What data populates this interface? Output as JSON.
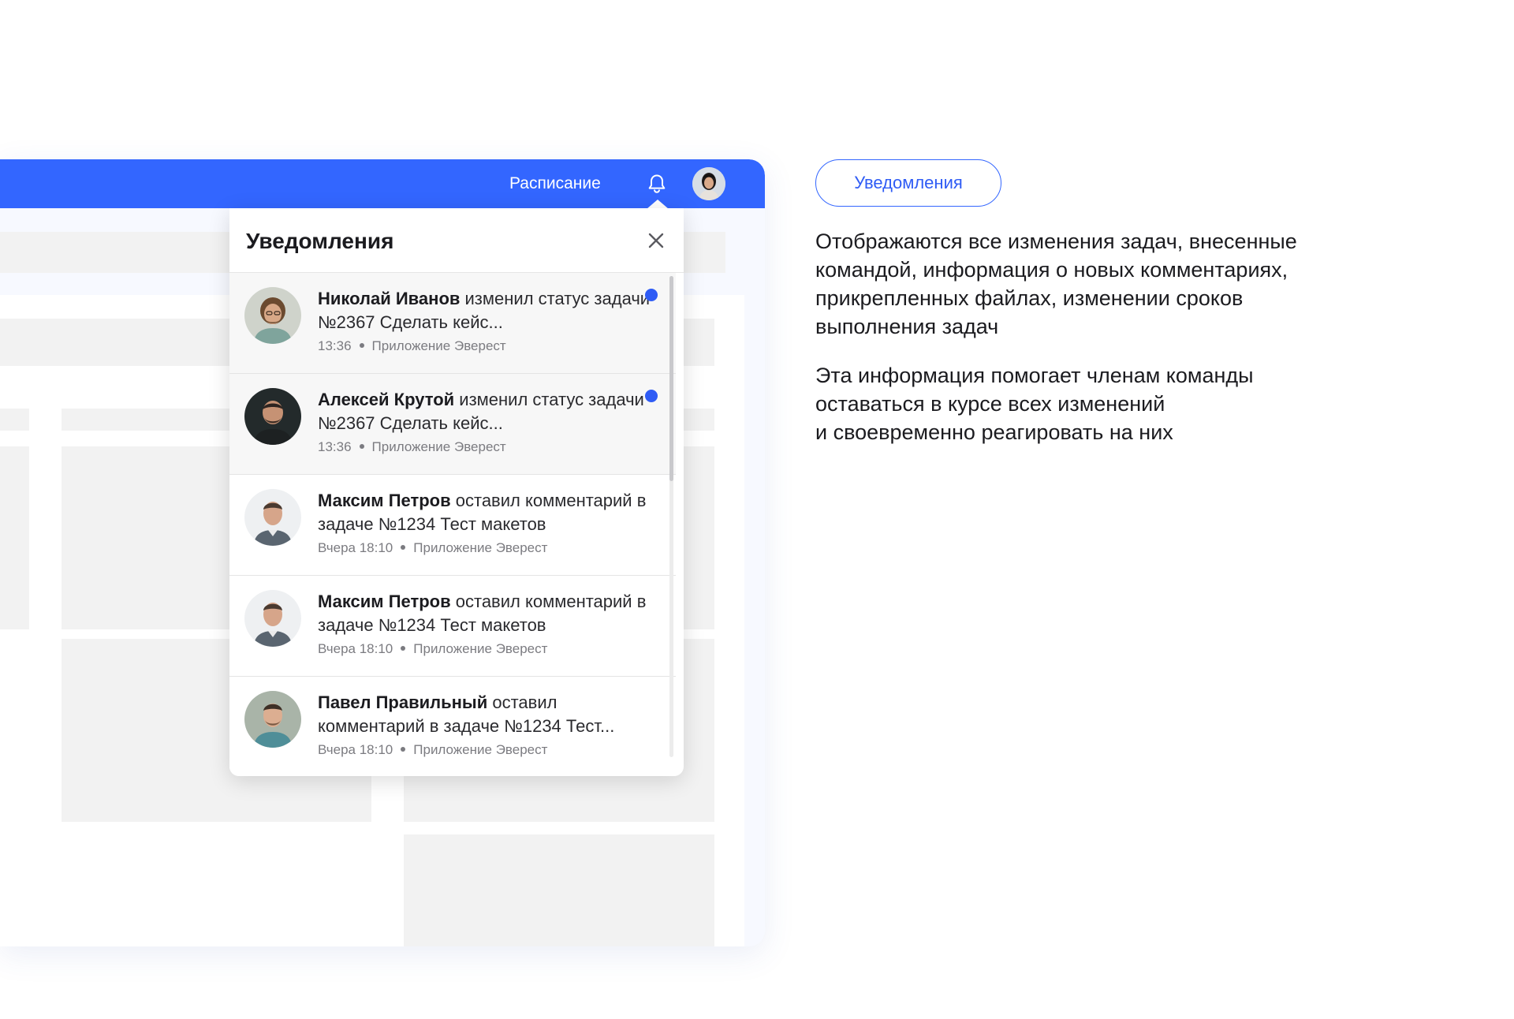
{
  "topbar": {
    "nav_link": "Расписание",
    "accent_color": "#3366ff"
  },
  "notifications": {
    "title": "Уведомления",
    "items": [
      {
        "author": "Николай Иванов",
        "text": " изменил статус задачи №2367 Сделать кейс...",
        "time": "13:36",
        "source": "Приложение Эверест",
        "unread": true
      },
      {
        "author": "Алексей Крутой",
        "text": " изменил статус задачи №2367 Сделать кейс...",
        "time": "13:36",
        "source": "Приложение Эверест",
        "unread": true
      },
      {
        "author": "Максим Петров",
        "text": " оставил комментарий в задаче №1234 Тест макетов",
        "time": "Вчера 18:10",
        "source": "Приложение Эверест",
        "unread": false
      },
      {
        "author": "Максим Петров",
        "text": " оставил комментарий в задаче №1234 Тест макетов",
        "time": "Вчера 18:10",
        "source": "Приложение Эверест",
        "unread": false
      },
      {
        "author": "Павел Правильный",
        "text": " оставил комментарий в задаче №1234 Тест...",
        "time": "Вчера 18:10",
        "source": "Приложение Эверест",
        "unread": false
      }
    ]
  },
  "description": {
    "chip_label": "Уведомления",
    "paragraph1": [
      "Отображаются все изменения задач, внесенные",
      "командой, информация о новых комментариях,",
      "прикрепленных файлах, изменении сроков",
      "выполнения задач"
    ],
    "paragraph2": [
      "Эта информация помогает членам команды",
      "оставаться в курсе всех изменений",
      "и своевременно реагировать на них"
    ]
  },
  "icons": {
    "bell": "bell-icon",
    "close": "close-icon",
    "unread": "unread-dot-icon"
  }
}
